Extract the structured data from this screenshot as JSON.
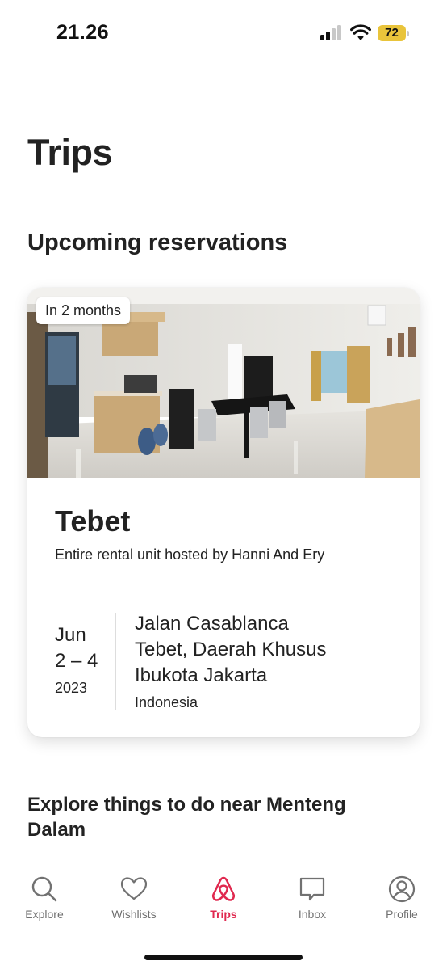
{
  "status_bar": {
    "time": "21.26",
    "battery": "72",
    "battery_color": "#e9c43b"
  },
  "page": {
    "title": "Trips"
  },
  "upcoming": {
    "heading": "Upcoming reservations",
    "reservation": {
      "badge": "In 2 months",
      "title": "Tebet",
      "subtitle": "Entire rental unit hosted by Hanni And Ery",
      "date": {
        "month": "Jun",
        "range": "2 – 4",
        "year": "2023"
      },
      "address": {
        "line1": "Jalan Casablanca",
        "line2": "Tebet, Daerah Khusus",
        "line3": "Ibukota Jakarta",
        "country": "Indonesia"
      }
    }
  },
  "explore": {
    "heading": "Explore things to do near Menteng Dalam"
  },
  "tab_bar": {
    "accent_color": "#e0294f",
    "tabs": [
      {
        "label": "Explore",
        "icon": "search-icon",
        "active": false
      },
      {
        "label": "Wishlists",
        "icon": "heart-icon",
        "active": false
      },
      {
        "label": "Trips",
        "icon": "airbnb-logo-icon",
        "active": true
      },
      {
        "label": "Inbox",
        "icon": "message-icon",
        "active": false
      },
      {
        "label": "Profile",
        "icon": "profile-icon",
        "active": false
      }
    ]
  }
}
